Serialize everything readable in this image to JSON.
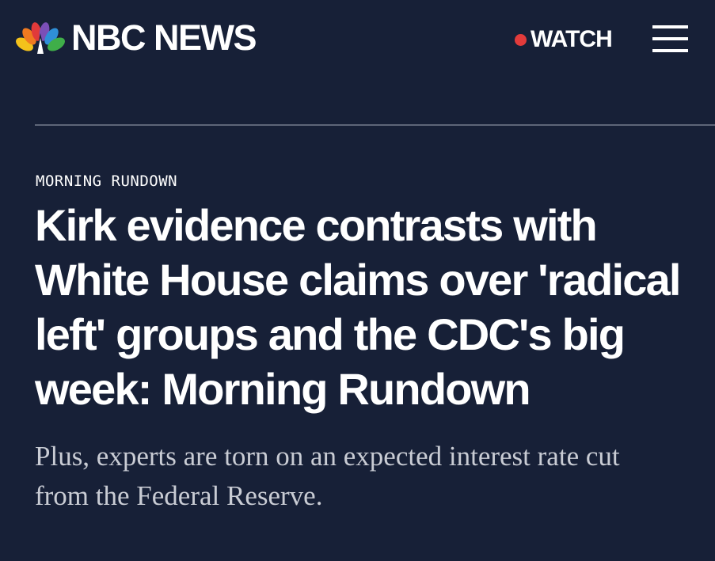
{
  "header": {
    "brand": "NBC NEWS",
    "logo_icon": "nbc-peacock-icon",
    "watch_label": "WATCH",
    "live_dot_color": "#e23b3b",
    "menu_icon": "hamburger-menu-icon"
  },
  "article": {
    "eyebrow": "MORNING RUNDOWN",
    "headline_lines": [
      "Kirk evidence contrasts with",
      "White House claims over 'radical",
      "left' groups and the CDC's big",
      "week: Morning Rundown"
    ],
    "dek_lines": [
      "Plus, experts are torn on an expected interest rate cut",
      "from the Federal Reserve."
    ]
  },
  "colors": {
    "background": "#172037",
    "divider": "#5e6678",
    "dek_text": "#c9ccd4"
  }
}
